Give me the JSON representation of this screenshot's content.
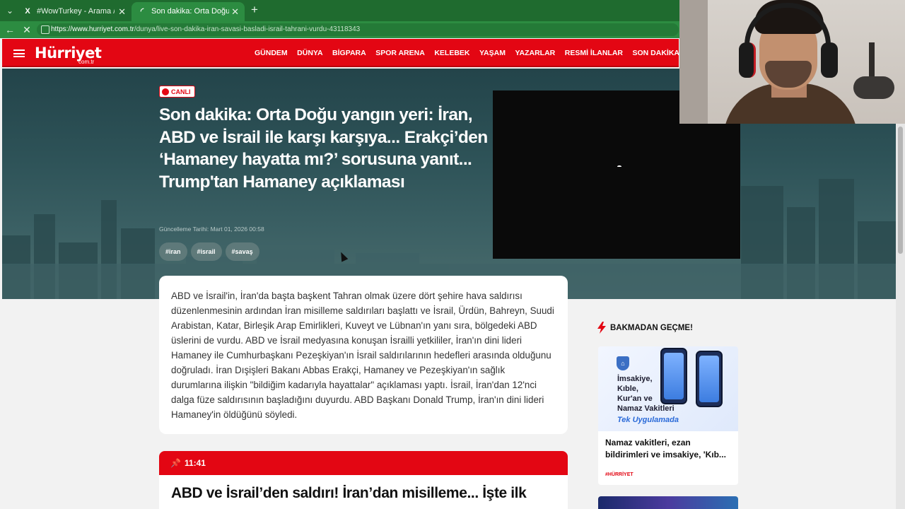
{
  "browser": {
    "tabs": [
      {
        "title": "#WowTurkey - Arama / X",
        "favicon": "x-logo-icon",
        "active": false
      },
      {
        "title": "Son dakika: Orta Doğu yangın yeri: İran",
        "favicon": "loading-icon",
        "active": true
      }
    ],
    "url_host": "https://www.hurriyet.com.tr",
    "url_path": "/dunya/live-son-dakika-iran-savasi-basladi-israil-tahrani-vurdu-43118343",
    "theme_color": "#2c8c41"
  },
  "site": {
    "logo": "Hürriyet",
    "logo_sub": "com.tr",
    "brand_color": "#e30613",
    "nav": [
      "GÜNDEM",
      "DÜNYA",
      "BİGPARA",
      "SPOR ARENA",
      "KELEBEK",
      "YAŞAM",
      "YAZARLAR",
      "RESMİ İLANLAR",
      "SON DAKİKA"
    ]
  },
  "article": {
    "badge": "CANLI",
    "title": "Son dakika: Orta Doğu yangın yeri: İran, ABD ve İsrail ile karşı karşıya... Erakçi’den ‘Hamaney hayatta mı?’ sorusuna yanıt... Trump'tan Hamaney açıklaması",
    "updated": "Güncelleme Tarihi: Mart 01, 2026 00:58",
    "tags": [
      "#iran",
      "#israil",
      "#savaş"
    ],
    "summary": "ABD ve İsrail'in, İran'da başta başkent Tahran olmak üzere dört şehire hava saldırısı düzenlenmesinin ardından İran misilleme saldırıları başlattı ve İsrail, Ürdün, Bahreyn, Suudi Arabistan, Katar, Birleşik Arap Emirlikleri, Kuveyt ve Lübnan'ın yanı sıra, bölgedeki ABD üslerini de vurdu. ABD ve İsrail medyasına konuşan İsrailli yetkililer, İran'ın dini lideri Hamaney ile Cumhurbaşkanı Pezeşkiyan'ın İsrail saldırılarının hedefleri arasında olduğunu doğruladı. İran Dışişleri Bakanı Abbas Erakçi, Hamaney ve Pezeşkiyan'ın sağlık durumlarına ilişkin \"bildiğim kadarıyla hayattalar\" açıklaması yaptı. İsrail, İran'dan 12'nci dalga füze saldırısının başladığını duyurdu. ABD Başkanı Donald Trump, İran'ın dini lideri Hamaney'in öldüğünü söyledi."
  },
  "live_entry": {
    "time": "11:41",
    "title": "ABD ve İsrail’den saldırı! İran’dan misilleme... İşte ilk"
  },
  "sidebar": {
    "title": "BAKMADAN GEÇME!",
    "card": {
      "promo_lines": [
        "İmsakiye,",
        "Kıble,",
        "Kur'an ve",
        "Namaz Vakitleri"
      ],
      "promo_accent": "Tek Uygulamada",
      "headline": "Namaz vakitleri, ezan bildirimleri ve imsakiye, 'Kıb...",
      "source": "#HÜRRİYET"
    }
  }
}
